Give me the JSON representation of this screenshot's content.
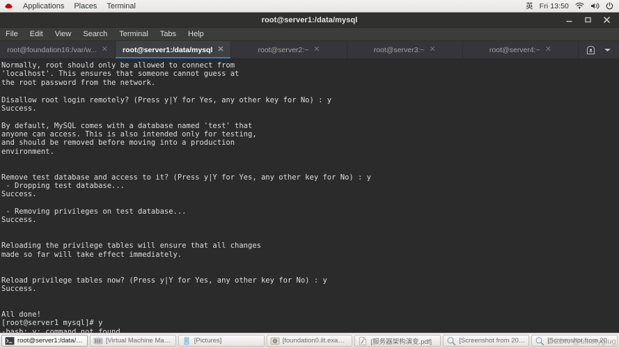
{
  "gnome_topbar": {
    "logo_icon": "redhat-logo-icon",
    "items": [
      {
        "label": "Applications"
      },
      {
        "label": "Places"
      },
      {
        "label": "Terminal"
      }
    ],
    "ime": "英",
    "clock": "Fri 13:50",
    "tray": [
      {
        "icon": "wifi-icon"
      },
      {
        "icon": "volume-icon"
      },
      {
        "icon": "power-icon"
      }
    ]
  },
  "window": {
    "title": "root@server1:/data/mysql",
    "controls": [
      {
        "name": "minimize",
        "icon": "minimize-icon"
      },
      {
        "name": "maximize",
        "icon": "maximize-icon"
      },
      {
        "name": "close",
        "icon": "close-icon"
      }
    ]
  },
  "menubar": {
    "items": [
      {
        "label": "File"
      },
      {
        "label": "Edit"
      },
      {
        "label": "View"
      },
      {
        "label": "Search"
      },
      {
        "label": "Terminal"
      },
      {
        "label": "Tabs"
      },
      {
        "label": "Help"
      }
    ]
  },
  "tabs": {
    "items": [
      {
        "label": "root@foundation16:/var/w...",
        "active": false,
        "close": "✕"
      },
      {
        "label": "root@server1:/data/mysql",
        "active": true,
        "close": "✕"
      },
      {
        "label": "root@server2:~",
        "active": false,
        "close": "✕"
      },
      {
        "label": "root@server3:~",
        "active": false,
        "close": "✕"
      },
      {
        "label": "root@server4:~",
        "active": false,
        "close": "✕"
      }
    ],
    "tools": [
      {
        "icon": "new-tab-icon"
      },
      {
        "icon": "chevron-down-icon"
      }
    ],
    "active_indicator_color": "#2a7fd4"
  },
  "terminal": {
    "background_color": "#2b2b2b",
    "text_color": "#dedede",
    "lines": [
      "Normally, root should only be allowed to connect from",
      "'localhost'. This ensures that someone cannot guess at",
      "the root password from the network.",
      "",
      "Disallow root login remotely? (Press y|Y for Yes, any other key for No) : y",
      "Success.",
      "",
      "By default, MySQL comes with a database named 'test' that",
      "anyone can access. This is also intended only for testing,",
      "and should be removed before moving into a production",
      "environment.",
      "",
      "",
      "Remove test database and access to it? (Press y|Y for Yes, any other key for No) : y",
      " - Dropping test database...",
      "Success.",
      "",
      " - Removing privileges on test database...",
      "Success.",
      "",
      "",
      "Reloading the privilege tables will ensure that all changes",
      "made so far will take effect immediately.",
      "",
      "",
      "Reload privilege tables now? (Press y|Y for Yes, any other key for No) : y",
      "Success.",
      "",
      "",
      "All done!",
      "[root@server1 mysql]# y",
      "-bash: y: command not found"
    ],
    "prompt": "[root@server1 mysql]# ",
    "cursor": "block-cursor"
  },
  "taskbar": {
    "items": [
      {
        "label": "root@server1:/data/m...",
        "icon": "terminal-icon",
        "active": true
      },
      {
        "label": "[Virtual Machine Manag...",
        "icon": "vm-manager-icon",
        "active": false
      },
      {
        "label": "[Pictures]",
        "icon": "folder-icon",
        "active": false
      },
      {
        "label": "[foundation0.ilt.exampl..",
        "icon": "vm-viewer-icon",
        "active": false
      },
      {
        "label": "[服务器架构演变.pdf]",
        "icon": "pdf-icon",
        "active": false
      },
      {
        "label": "[Screenshot from 202...",
        "icon": "image-viewer-icon",
        "active": false
      },
      {
        "label": "[Screenshot from 202...",
        "icon": "image-viewer-icon",
        "active": false
      }
    ]
  },
  "watermark": {
    "text": "CSDN @uikotyglug"
  }
}
